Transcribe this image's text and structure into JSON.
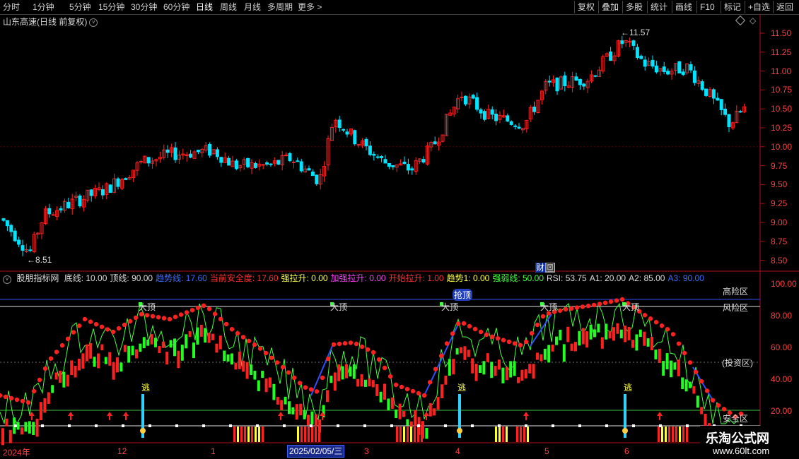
{
  "toolbar": {
    "periods": [
      "分时",
      "1分钟",
      "5分钟",
      "15分钟",
      "30分钟",
      "60分钟",
      "日线",
      "周线",
      "月线",
      "多周期",
      "更多 >"
    ],
    "active_period": "日线",
    "right_buttons": [
      "复权",
      "叠加",
      "多股",
      "统计",
      "画线",
      "F10",
      "标记",
      "+自选",
      "返回"
    ]
  },
  "main_chart": {
    "title": "山东高速(日线 前复权)",
    "high_marker": "11.57",
    "low_marker": "8.51",
    "financial_badge": "财",
    "return_badge": "回",
    "y_ticks": [
      "11.50",
      "11.25",
      "11.00",
      "10.75",
      "10.50",
      "10.25",
      "10.00",
      "9.75",
      "9.50",
      "9.25",
      "9.00",
      "8.75",
      "8.50"
    ],
    "up_color": "#ff2020",
    "down_color": "#00e5ff"
  },
  "indicator": {
    "name": "股朋指标网",
    "params": [
      {
        "text": "底线: 10.00",
        "color": "#dcdcdc"
      },
      {
        "text": "顶线: 90.00",
        "color": "#dcdcdc"
      },
      {
        "text": "趋势线: 17.60",
        "color": "#3a6cff"
      },
      {
        "text": "当前安全度: 17.60",
        "color": "#ff3030"
      },
      {
        "text": "强拉升: 0.00",
        "color": "#ffff40"
      },
      {
        "text": "加强拉升: 0.00",
        "color": "#ff40ff"
      },
      {
        "text": "开始拉升: 1.00",
        "color": "#ff3030"
      },
      {
        "text": "趋势1: 0.00",
        "color": "#ffff40"
      },
      {
        "text": "强弱线: 50.00",
        "color": "#40ff40"
      },
      {
        "text": "RSI: 53.75",
        "color": "#dcdcdc"
      },
      {
        "text": "A1: 20.00",
        "color": "#dcdcdc"
      },
      {
        "text": "A2: 85.00",
        "color": "#dcdcdc"
      },
      {
        "text": "A3: 90.00",
        "color": "#3a6cff"
      }
    ],
    "y_ticks": [
      "100.00",
      "80.00",
      "60.00",
      "40.00",
      "20.00"
    ],
    "zones": {
      "high": "高险区",
      "risk": "风险区",
      "invest": "(投资区)",
      "safe": "安全区"
    },
    "labels": {
      "top": "大顶",
      "escape": "逃",
      "grab_top": "抢顶"
    }
  },
  "date_axis": {
    "labels": [
      "2024年",
      "12",
      "1",
      "3",
      "4",
      "5",
      "6"
    ],
    "highlight": "2025/02/05/三"
  },
  "watermark": {
    "name": "乐淘公式网",
    "url": "www.60lt.com"
  }
}
